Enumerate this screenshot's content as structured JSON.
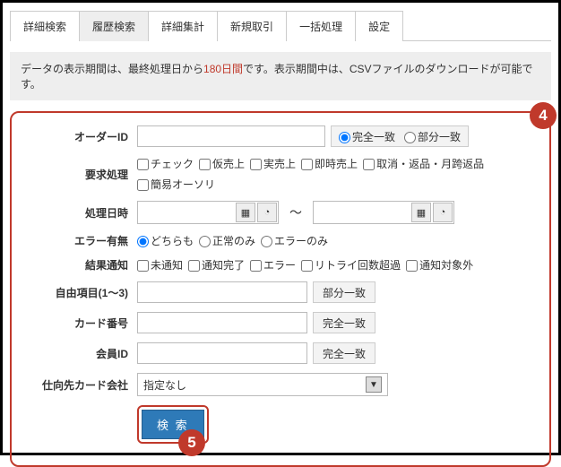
{
  "tabs": [
    {
      "label": "詳細検索"
    },
    {
      "label": "履歴検索"
    },
    {
      "label": "詳細集計"
    },
    {
      "label": "新規取引"
    },
    {
      "label": "一括処理"
    },
    {
      "label": "設定"
    }
  ],
  "info": {
    "p1": "データの表示期間は、最終処理日から",
    "days": "180日間",
    "p2": "です。表示期間中は、CSVファイルのダウンロードが可能です。"
  },
  "labels": {
    "orderId": "オーダーID",
    "request": "要求処理",
    "procDate": "処理日時",
    "error": "エラー有無",
    "notify": "結果通知",
    "free": "自由項目(1～3)",
    "cardNo": "カード番号",
    "memberId": "会員ID",
    "destCard": "仕向先カード会社"
  },
  "match": {
    "full": "完全一致",
    "partial": "部分一致"
  },
  "request": {
    "check": "チェック",
    "prov": "仮売上",
    "real": "実売上",
    "instant": "即時売上",
    "cancelReturn": "取消・返品・月跨返品",
    "simpleAuth": "簡易オーソリ"
  },
  "date": {
    "tilde": "～"
  },
  "error": {
    "both": "どちらも",
    "okOnly": "正常のみ",
    "errOnly": "エラーのみ"
  },
  "notify": {
    "none": "未通知",
    "done": "通知完了",
    "err": "エラー",
    "retryOver": "リトライ回数超過",
    "excluded": "通知対象外"
  },
  "select": {
    "none": "指定なし"
  },
  "search": "検 索",
  "badge": {
    "n4": "4",
    "n5": "5"
  }
}
